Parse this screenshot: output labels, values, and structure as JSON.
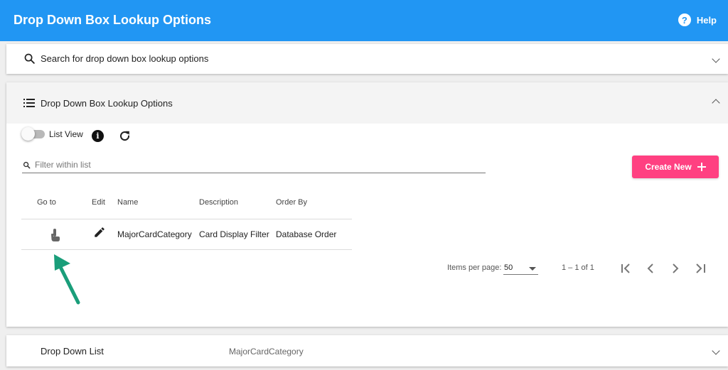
{
  "header": {
    "title": "Drop Down Box Lookup Options",
    "help_label": "Help",
    "help_icon": "help-circle-icon"
  },
  "search_panel": {
    "label": "Search for drop down box lookup options"
  },
  "options_panel": {
    "title": "Drop Down Box Lookup Options",
    "list_view_label": "List View",
    "list_view_on": false,
    "filter_placeholder": "Filter within list",
    "create_new_label": "Create New",
    "table": {
      "headers": {
        "goto": "Go to",
        "edit": "Edit",
        "name": "Name",
        "description": "Description",
        "order_by": "Order By"
      },
      "rows": [
        {
          "name": "MajorCardCategory",
          "description": "Card Display Filter",
          "order_by": "Database Order"
        }
      ]
    },
    "paginator": {
      "items_per_page_label": "Items per page:",
      "page_size": "50",
      "range_label": "1 – 1 of 1"
    }
  },
  "drop_down_list_panel": {
    "label": "Drop Down List",
    "value": "MajorCardCategory"
  },
  "colors": {
    "primary": "#2196f3",
    "accent": "#ff4081",
    "annotation_arrow": "#1a9e7a"
  }
}
